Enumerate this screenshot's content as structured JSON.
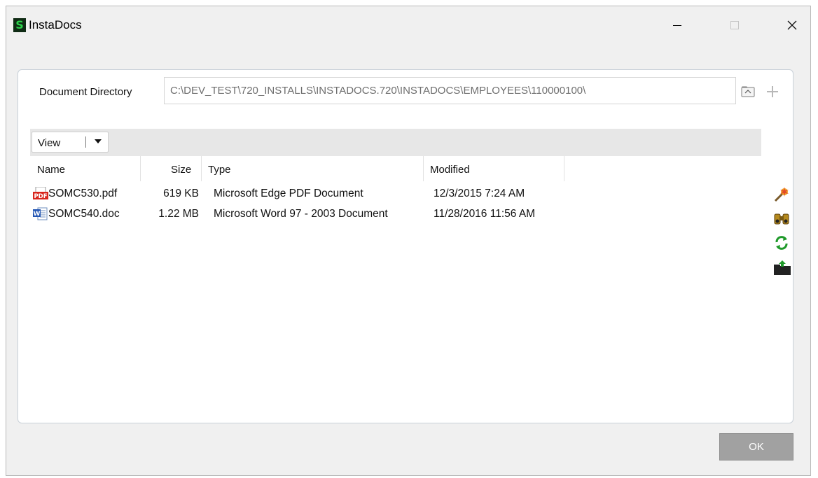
{
  "window": {
    "title": "InstaDocs",
    "app_icon_glyph": "S",
    "app_icon_color": "#2bd24a",
    "controls": {
      "minimize": "minimize-icon",
      "maximize": "maximize-icon",
      "close": "close-icon"
    }
  },
  "directory": {
    "label": "Document Directory",
    "value": "C:\\DEV_TEST\\720_INSTALLS\\INSTADOCS.720\\INSTADOCS\\EMPLOYEES\\110000100\\",
    "browse_icon": "folder-browse-icon",
    "add_icon": "plus-icon"
  },
  "toolbar": {
    "view_label": "View",
    "view_dropdown_icon": "chevron-down-icon"
  },
  "table": {
    "columns": [
      "Name",
      "Size",
      "Type",
      "Modified"
    ],
    "rows": [
      {
        "icon": "pdf-file-icon",
        "name": "SOMC530.pdf",
        "size": "619 KB",
        "type": "Microsoft Edge PDF Document",
        "modified": "12/3/2015 7:24 AM"
      },
      {
        "icon": "word-file-icon",
        "name": "SOMC540.doc",
        "size": "1.22 MB",
        "type": "Microsoft Word 97 - 2003 Document",
        "modified": "11/28/2016 11:56 AM"
      }
    ]
  },
  "side_actions": [
    {
      "icon": "wizard-icon"
    },
    {
      "icon": "binoculars-icon"
    },
    {
      "icon": "refresh-icon"
    },
    {
      "icon": "upload-folder-icon"
    }
  ],
  "footer": {
    "ok_label": "OK"
  }
}
